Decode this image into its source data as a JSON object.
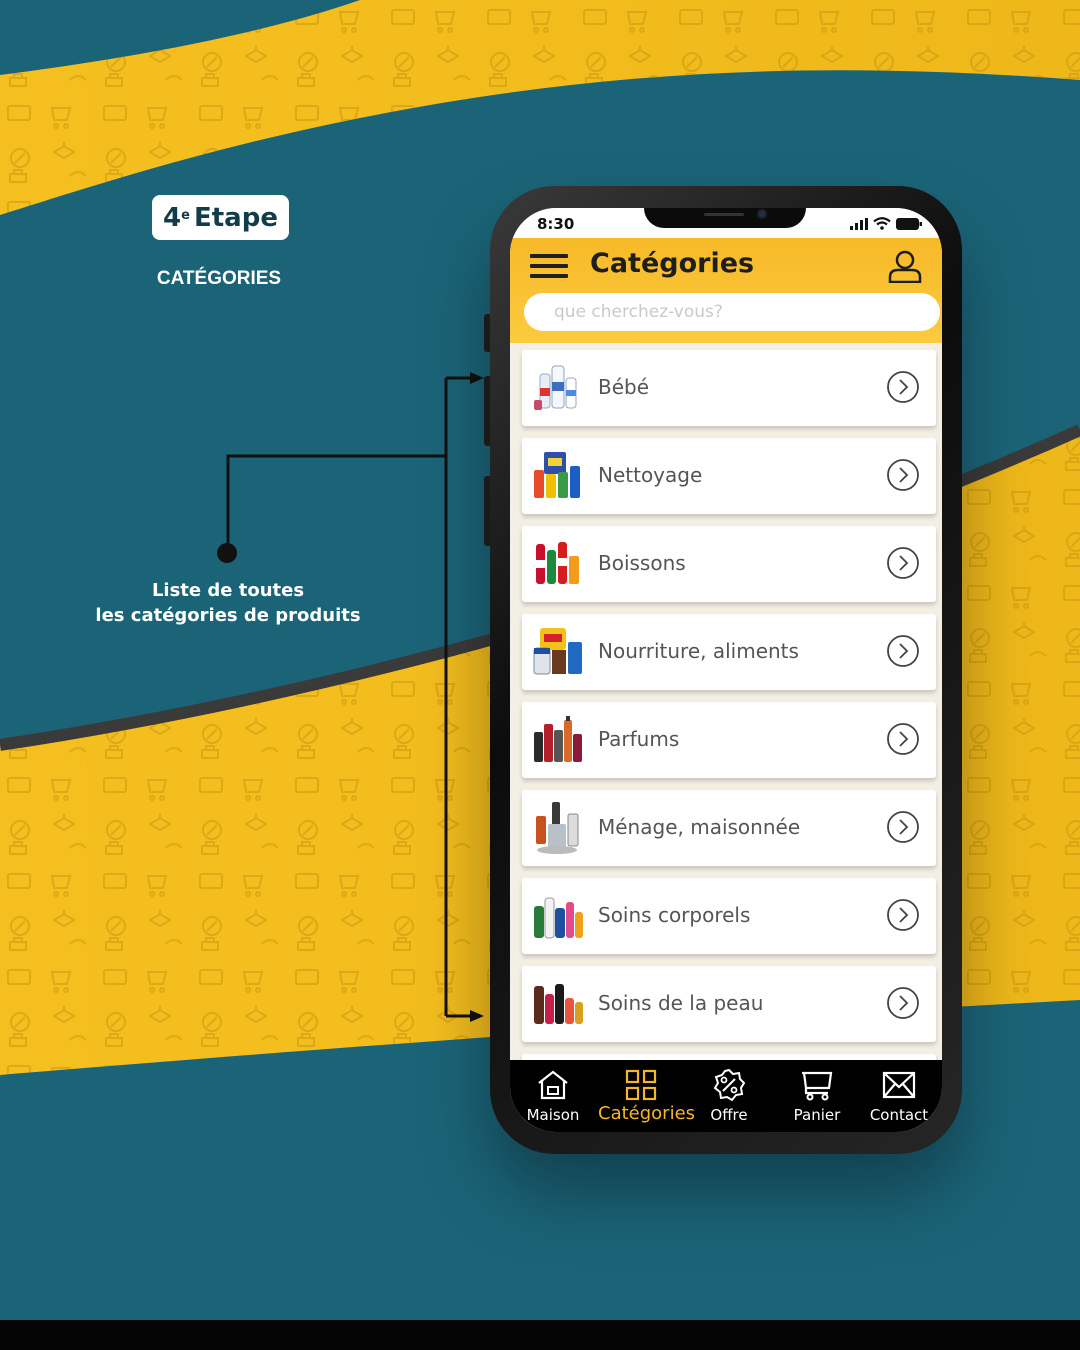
{
  "step": {
    "number": "4",
    "suffix": "e",
    "word": "Etape",
    "title": "CATÉGORIES"
  },
  "callout": {
    "line1": "Liste de toutes",
    "line2": "les catégories de produits"
  },
  "status": {
    "time": "8:30"
  },
  "app": {
    "title": "Catégories",
    "search_placeholder": "que cherchez-vous?"
  },
  "categories": [
    {
      "label": "Bébé",
      "thumb_icon": "baby-products-icon"
    },
    {
      "label": "Nettoyage",
      "thumb_icon": "cleaning-products-icon"
    },
    {
      "label": "Boissons",
      "thumb_icon": "drinks-icon"
    },
    {
      "label": "Nourriture, aliments",
      "thumb_icon": "food-icon"
    },
    {
      "label": "Parfums",
      "thumb_icon": "perfume-icon"
    },
    {
      "label": "Ménage, maisonnée",
      "thumb_icon": "household-icon"
    },
    {
      "label": "Soins corporels",
      "thumb_icon": "body-care-icon"
    },
    {
      "label": "Soins de la peau",
      "thumb_icon": "skin-care-icon"
    }
  ],
  "nav": {
    "active": "Catégories",
    "items": [
      {
        "label": "Maison",
        "icon": "home-icon"
      },
      {
        "label": "Catégories",
        "icon": "grid-icon"
      },
      {
        "label": "Offre",
        "icon": "offer-percent-icon"
      },
      {
        "label": "Panier",
        "icon": "cart-icon"
      },
      {
        "label": "Contact",
        "icon": "mail-icon"
      }
    ]
  },
  "colors": {
    "background": "#1b6478",
    "accent": "#f7b52a",
    "band": "#f2bd1d",
    "navbar": "#000000",
    "text_dark": "#1e1e1e"
  }
}
